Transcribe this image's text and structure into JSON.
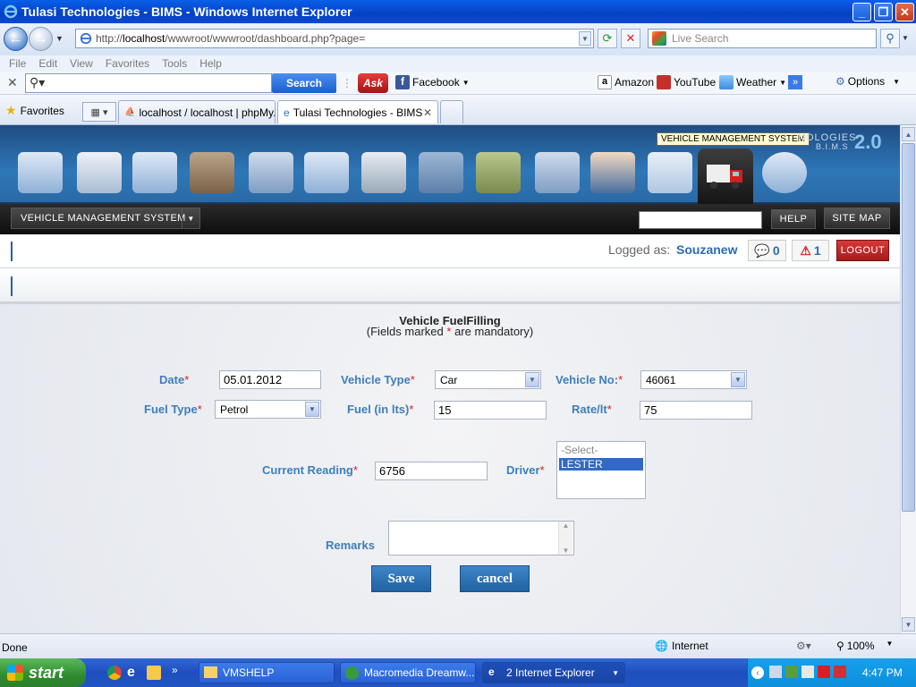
{
  "window": {
    "title": "Tulasi Technologies - BIMS - Windows Internet Explorer"
  },
  "browser": {
    "url_prefix": "http://",
    "url_host": "localhost",
    "url_path": "/wwwroot/wwwroot/dashboard.php?page=",
    "search_placeholder": "Live Search",
    "menu": [
      "File",
      "Edit",
      "View",
      "Favorites",
      "Tools",
      "Help"
    ],
    "toolbar": {
      "search_button": "Search",
      "facebook": "Facebook",
      "amazon": "Amazon",
      "youtube": "YouTube",
      "weather": "Weather",
      "options": "Options",
      "more": "»"
    },
    "favorites_label": "Favorites",
    "tabs": [
      {
        "label": "localhost / localhost | phpMy..."
      },
      {
        "label": "Tulasi Technologies - BIMS"
      }
    ]
  },
  "app": {
    "brand_partial": "NOLOGIES",
    "brand_sub": "B.I.M.S",
    "version": "2.0",
    "tooltip": "VEHICLE MANAGEMENT SYSTEM",
    "module_button": "VEHICLE MANAGEMENT SYSTEM",
    "help_button": "HELP",
    "sitemap_button": "SITE MAP",
    "logged_as_label": "Logged as:",
    "username": "Souzanew",
    "messages_count": "0",
    "alerts_count": "1",
    "logout_button": "LOGOUT"
  },
  "form": {
    "title": "Vehicle FuelFilling",
    "subtitle_before": "(Fields marked",
    "subtitle_star": "*",
    "subtitle_after": "are mandatory)",
    "date_label": "Date",
    "date_value": "05.01.2012",
    "vehicle_type_label": "Vehicle Type",
    "vehicle_type_value": "Car",
    "vehicle_no_label": "Vehicle No:",
    "vehicle_no_value": "46061",
    "fuel_type_label": "Fuel Type",
    "fuel_type_value": "Petrol",
    "fuel_label": "Fuel (in lts)",
    "fuel_value": "15",
    "rate_label": "Rate/lt",
    "rate_value": "75",
    "reading_label": "Current Reading",
    "reading_value": "6756",
    "driver_label": "Driver",
    "driver_options": [
      "-Select-",
      "LESTER"
    ],
    "driver_selected": "LESTER",
    "remarks_label": "Remarks",
    "remarks_value": "",
    "save_button": "Save",
    "cancel_button": "cancel",
    "required_star": "*"
  },
  "status": {
    "text": "Done",
    "zone": "Internet",
    "zoom": "100%"
  },
  "taskbar": {
    "start": "start",
    "tasks": [
      "VMSHELP",
      "Macromedia Dreamw...",
      "2 Internet Explorer"
    ],
    "clock": "4:47 PM"
  }
}
